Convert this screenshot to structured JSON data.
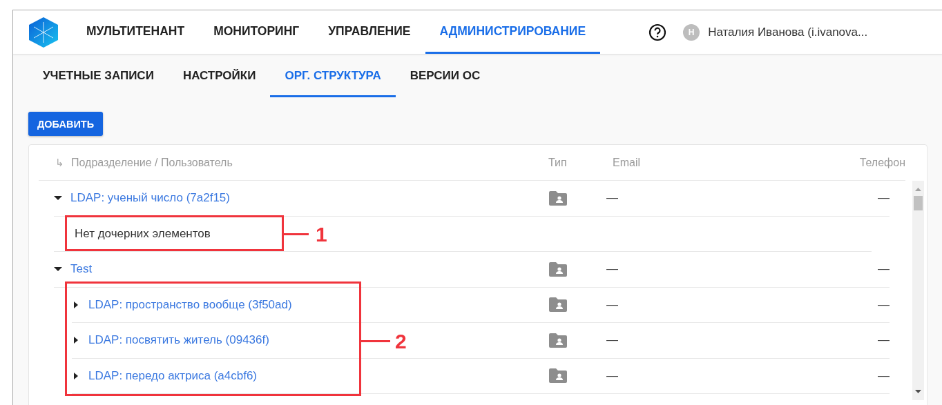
{
  "nav": {
    "tabs": [
      {
        "label": "МУЛЬТИТЕНАНТ",
        "selected": false
      },
      {
        "label": "МОНИТОРИНГ",
        "selected": false
      },
      {
        "label": "УПРАВЛЕНИЕ",
        "selected": false
      },
      {
        "label": "АДМИНИСТРИРОВАНИЕ",
        "selected": true
      }
    ],
    "user": {
      "initial": "Н",
      "name": "Наталия Иванова (i.ivanova..."
    }
  },
  "subtabs": [
    {
      "label": "УЧЕТНЫЕ ЗАПИСИ",
      "selected": false
    },
    {
      "label": "НАСТРОЙКИ",
      "selected": false
    },
    {
      "label": "ОРГ. СТРУКТУРА",
      "selected": true
    },
    {
      "label": "ВЕРСИИ ОС",
      "selected": false
    }
  ],
  "add_button": "ДОБАВИТЬ",
  "table": {
    "header_icon": "↳",
    "columns": [
      "Подразделение / Пользователь",
      "Тип",
      "Email",
      "Телефон"
    ],
    "rows": [
      {
        "kind": "unit",
        "name": "LDAP: ученый число (7a2f15)",
        "expanded": true,
        "email": "—",
        "phone": "—",
        "children": [
          {
            "kind": "empty",
            "name": "Нет дочерних элементов"
          }
        ]
      },
      {
        "kind": "unit",
        "name": "Test",
        "expanded": true,
        "email": "—",
        "phone": "—",
        "children": [
          {
            "kind": "unit",
            "name": "LDAP: пространство вообще (3f50ad)",
            "expanded": false,
            "email": "—",
            "phone": "—"
          },
          {
            "kind": "unit",
            "name": "LDAP: посвятить житель (09436f)",
            "expanded": false,
            "email": "—",
            "phone": "—"
          },
          {
            "kind": "unit",
            "name": "LDAP: передо актриса (a4cbf6)",
            "expanded": false,
            "email": "—",
            "phone": "—"
          }
        ]
      }
    ]
  },
  "callouts": [
    {
      "label": "1"
    },
    {
      "label": "2"
    }
  ]
}
